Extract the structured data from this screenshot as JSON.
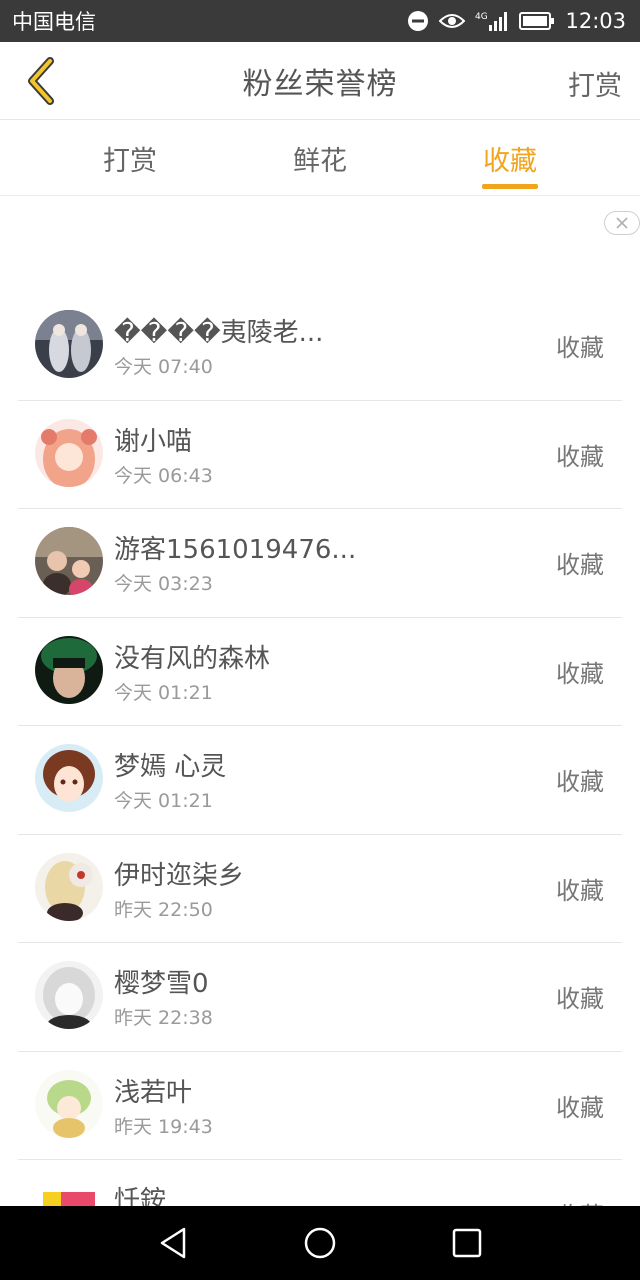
{
  "status_bar": {
    "carrier": "中国电信",
    "network": "4G",
    "time": "12:03"
  },
  "header": {
    "title": "粉丝荣誉榜",
    "action": "打赏",
    "back_icon": "chevron-left-icon"
  },
  "tabs": [
    {
      "label": "打赏",
      "active": false
    },
    {
      "label": "鲜花",
      "active": false
    },
    {
      "label": "收藏",
      "active": true
    }
  ],
  "colors": {
    "accent": "#f2a51c",
    "text_primary": "#555555",
    "text_secondary": "#9a9a9a",
    "status_bar_bg": "#3a3a3a",
    "nav_bar_bg": "#000000"
  },
  "list": [
    {
      "name": "����夷陵老...",
      "time": "今天 07:40",
      "action": "收藏"
    },
    {
      "name": "谢小喵",
      "time": "今天 06:43",
      "action": "收藏"
    },
    {
      "name": "游客1561019476...",
      "time": "今天 03:23",
      "action": "收藏"
    },
    {
      "name": "没有风的森林",
      "time": "今天 01:21",
      "action": "收藏"
    },
    {
      "name": "梦嫣 心灵",
      "time": "今天 01:21",
      "action": "收藏"
    },
    {
      "name": "伊时迩柒乡",
      "time": "昨天 22:50",
      "action": "收藏"
    },
    {
      "name": "樱梦雪0",
      "time": "昨天 22:38",
      "action": "收藏"
    },
    {
      "name": "浅若叶",
      "time": "昨天 19:43",
      "action": "收藏"
    },
    {
      "name": "忏銨",
      "time": "",
      "action": "收藏"
    }
  ]
}
